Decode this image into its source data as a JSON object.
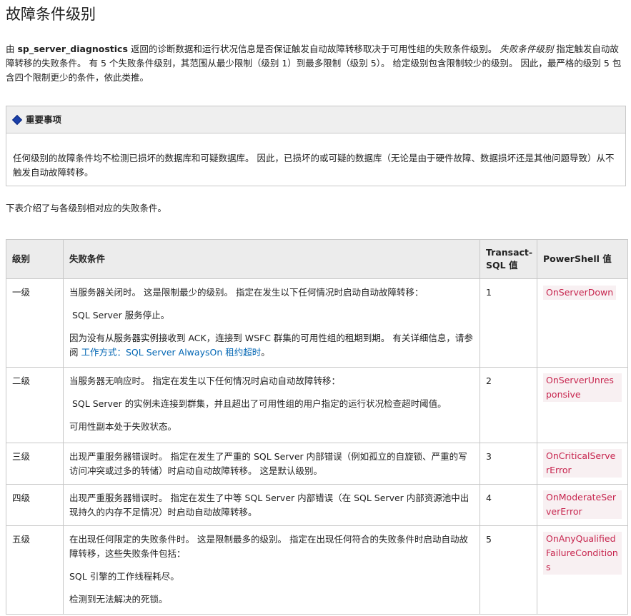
{
  "title": "故障条件级别",
  "intro": {
    "prefix": "由 ",
    "bold": "sp_server_diagnostics",
    "mid": " 返回的诊断数据和运行状况信息是否保证触发自动故障转移取决于可用性组的失败条件级别。 ",
    "italic": "失败条件级别",
    "suffix": " 指定触发自动故障转移的失败条件。 有 5 个失败条件级别，其范围从最少限制（级别 1）到最多限制（级别 5）。 给定级别包含限制较少的级别。 因此，最严格的级别 5 包含四个限制更少的条件，依此类推。"
  },
  "alert": {
    "heading": "重要事项",
    "body": "任何级别的故障条件均不检测已损坏的数据库和可疑数据库。 因此，已损坏的或可疑的数据库（无论是由于硬件故障、数据损坏还是其他问题导致）从不触发自动故障转移。"
  },
  "lead": "下表介绍了与各级别相对应的失败条件。",
  "table": {
    "headers": [
      "级别",
      "失败条件",
      "Transact-SQL 值",
      "PowerShell 值"
    ],
    "rows": [
      {
        "level": "一级",
        "p1": "当服务器关闭时。 这是限制最少的级别。 指定在发生以下任何情况时启动自动故障转移：",
        "p2": "SQL Server 服务停止。",
        "p3": "因为没有从服务器实例接收到 ACK，连接到 WSFC 群集的可用性组的租期到期。 有关详细信息，请参阅 ",
        "link": "工作方式：SQL Server AlwaysOn 租约超时",
        "p3_end": "。",
        "tsql": "1",
        "ps": "OnServerDown"
      },
      {
        "level": "二级",
        "p1": "当服务器无响应时。 指定在发生以下任何情况时启动自动故障转移：",
        "p2": "SQL Server 的实例未连接到群集，并且超出了可用性组的用户指定的运行状况检查超时阈值。",
        "p3": "可用性副本处于失败状态。",
        "tsql": "2",
        "ps": "OnServerUnresponsive"
      },
      {
        "level": "三级",
        "p1": "出现严重服务器错误时。 指定在发生了严重的 SQL Server 内部错误（例如孤立的自旋锁、严重的写访问冲突或过多的转储）时启动自动故障转移。 这是默认级别。",
        "tsql": "3",
        "ps": "OnCriticalServerError"
      },
      {
        "level": "四级",
        "p1": "出现严重服务器错误时。 指定在发生了中等 SQL Server 内部错误（在 SQL Server 内部资源池中出现持久的内存不足情况）时启动自动故障转移。",
        "tsql": "4",
        "ps": "OnModerateServerError"
      },
      {
        "level": "五级",
        "p1": "在出现任何限定的失败条件时。 这是限制最多的级别。 指定在出现任何符合的失败条件时启动自动故障转移，这些失败条件包括：",
        "p2": "SQL 引擎的工作线程耗尽。",
        "p3": "检测到无法解决的死锁。",
        "tsql": "5",
        "ps": "OnAnyQualifiedFailureConditions"
      }
    ]
  }
}
